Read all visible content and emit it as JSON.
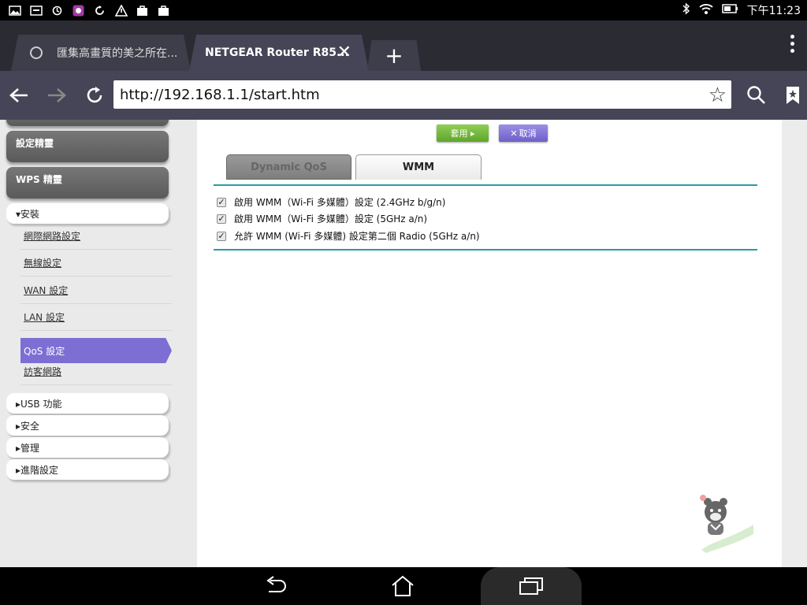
{
  "status_bar": {
    "time": "下午11:23",
    "left_icons": [
      "image-icon",
      "asus-icon",
      "sync-icon",
      "app-icon",
      "refresh-icon",
      "alert-icon",
      "bag-icon",
      "bag-icon"
    ],
    "right_icons": [
      "bluetooth-icon",
      "wifi-icon",
      "battery-icon"
    ]
  },
  "browser": {
    "tabs": [
      {
        "title": "匯集高畫質的美之所在...",
        "active": false
      },
      {
        "title": "NETGEAR Router R85...",
        "active": true
      }
    ],
    "url": "http://192.168.1.1/start.htm"
  },
  "sidebar": {
    "top_buttons": [
      {
        "label": "設定精靈"
      },
      {
        "label": "WPS 精靈"
      }
    ],
    "install_section": {
      "label": "▾安裝",
      "items": [
        {
          "label": "網際網路設定",
          "active": false
        },
        {
          "label": "無線設定",
          "active": false
        },
        {
          "label": "WAN 設定",
          "active": false
        },
        {
          "label": "LAN 設定",
          "active": false
        },
        {
          "label": "QoS 設定",
          "active": true
        },
        {
          "label": "訪客網路",
          "active": false
        }
      ]
    },
    "collapsed_sections": [
      {
        "label": "▸USB 功能"
      },
      {
        "label": "▸安全"
      },
      {
        "label": "▸管理"
      },
      {
        "label": "▸進階設定"
      }
    ]
  },
  "main": {
    "apply_label": "套用 ▸",
    "cancel_label": "取消",
    "tabs": [
      {
        "label": "Dynamic QoS",
        "active": false
      },
      {
        "label": "WMM",
        "active": true
      }
    ],
    "options": [
      {
        "label": "啟用 WMM（Wi-Fi 多媒體）設定 (2.4GHz b/g/n)",
        "checked": true
      },
      {
        "label": "啟用 WMM（Wi-Fi 多媒體）設定 (5GHz a/n)",
        "checked": true
      },
      {
        "label": "允許 WMM (Wi-Fi 多媒體) 設定第二個 Radio (5GHz a/n)",
        "checked": true
      }
    ]
  },
  "colors": {
    "toolbar": "#454557",
    "tabstrip": "#2b2b33",
    "active_menu": "#7d6ed4",
    "apply": "#6cb536",
    "cancel": "#7d6ed4",
    "rule": "#2a9aa3"
  }
}
